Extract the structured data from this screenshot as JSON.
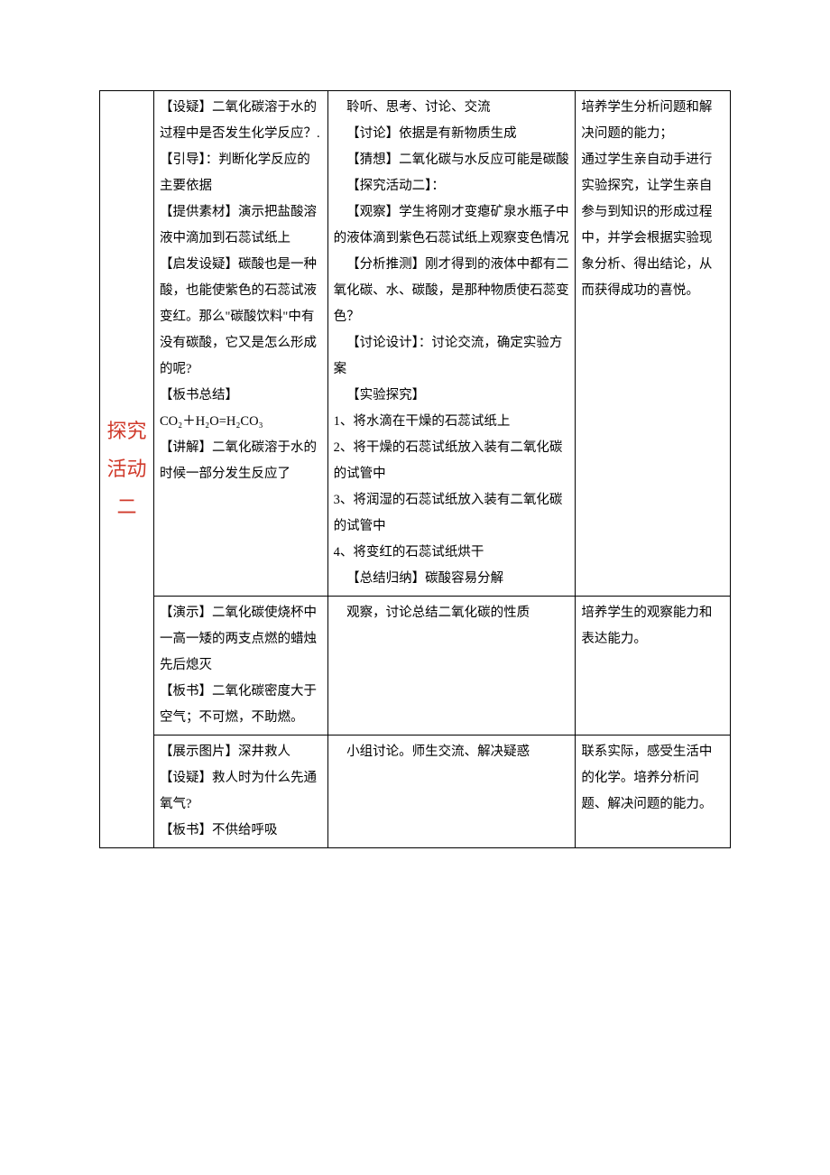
{
  "section_label": "探究活动二",
  "rows": [
    {
      "teacher": [
        "【设疑】二氧化碳溶于水的过程中是否发生化学反应？.",
        "【引导】：判断化学反应的主要依据",
        "【提供素材】演示把盐酸溶液中滴加到石蕊试纸上",
        "【启发设疑】碳酸也是一种酸，也能使紫色的石蕊试液变红。那么\"碳酸饮料\"中有没有碳酸，它又是怎么形成的呢?",
        "【板书总结】",
        "CO₂＋H₂O=H₂CO₃",
        "【讲解】二氧化碳溶于水的时候一部分发生反应了"
      ],
      "student": [
        "聆听、思考、讨论、交流",
        "",
        "【讨论】依据是有新物质生成",
        "【猜想】二氧化碳与水反应可能是碳酸",
        "【探究活动二】：",
        "【观察】学生将刚才变瘪矿泉水瓶子中的液体滴到紫色石蕊试纸上观察变色情况",
        "【分析推测】刚才得到的液体中都有二氧化碳、水、碳酸，是那种物质使石蕊变色？",
        "【讨论设计】：讨论交流，确定实验方案",
        "【实验探究】",
        "1、将水滴在干燥的石蕊试纸上",
        "2、将干燥的石蕊试纸放入装有二氧化碳的试管中",
        "3、将润湿的石蕊试纸放入装有二氧化碳的试管中",
        "4、将变红的石蕊试纸烘干",
        "【总结归纳】碳酸容易分解"
      ],
      "intent": [
        "培养学生分析问题和解决问题的能力；",
        "通过学生亲自动手进行实验探究，让学生亲自参与到知识的形成过程中，并学会根据实验现象分析、得出结论，从而获得成功的喜悦。"
      ]
    },
    {
      "teacher": [
        "【演示】二氧化碳使烧杯中一高一矮的两支点燃的蜡烛先后熄灭",
        "【板书】二氧化碳密度大于空气；不可燃，不助燃。"
      ],
      "student": [
        "观察，讨论总结二氧化碳的性质"
      ],
      "intent": [
        "培养学生的观察能力和表达能力。"
      ]
    },
    {
      "teacher": [
        "【展示图片】深井救人",
        "【设疑】救人时为什么先通氧气?",
        "【板书】不供给呼吸"
      ],
      "student": [
        "小组讨论。师生交流、解决疑惑"
      ],
      "intent": [
        "联系实际，感受生活中的化学。培养分析问题、解决问题的能力。"
      ]
    }
  ]
}
